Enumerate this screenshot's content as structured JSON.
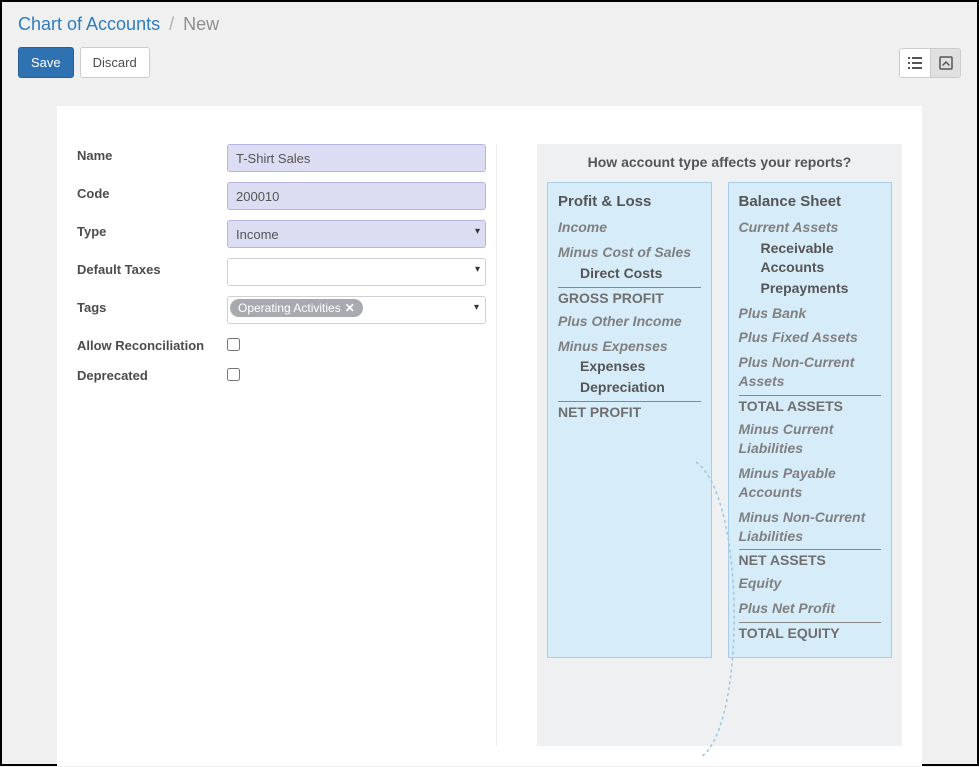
{
  "breadcrumb": {
    "parent": "Chart of Accounts",
    "current": "New"
  },
  "toolbar": {
    "save": "Save",
    "discard": "Discard"
  },
  "form": {
    "labels": {
      "name": "Name",
      "code": "Code",
      "type": "Type",
      "default_taxes": "Default Taxes",
      "tags": "Tags",
      "allow_reconciliation": "Allow Reconciliation",
      "deprecated": "Deprecated"
    },
    "values": {
      "name": "T-Shirt Sales",
      "code": "200010",
      "type": "Income",
      "default_taxes": "",
      "tags": [
        "Operating Activities"
      ],
      "allow_reconciliation": false,
      "deprecated": false
    }
  },
  "info": {
    "title": "How account type affects your reports?",
    "pl": {
      "title": "Profit & Loss",
      "income": "Income",
      "minus_cos": "Minus Cost of Sales",
      "direct_costs": "Direct Costs",
      "gross_profit": "GROSS PROFIT",
      "plus_other_income": "Plus Other Income",
      "minus_expenses": "Minus Expenses",
      "expenses": "Expenses",
      "depreciation": "Depreciation",
      "net_profit": "NET PROFIT"
    },
    "bs": {
      "title": "Balance Sheet",
      "current_assets": "Current Assets",
      "receivable": "Receivable Accounts",
      "prepayments": "Prepayments",
      "plus_bank": "Plus Bank",
      "plus_fixed": "Plus Fixed Assets",
      "plus_noncurrent": "Plus Non-Current Assets",
      "total_assets": "TOTAL ASSETS",
      "minus_current_liab": "Minus Current Liabilities",
      "minus_payable": "Minus Payable Accounts",
      "minus_noncurrent_liab": "Minus Non-Current Liabilities",
      "net_assets": "NET ASSETS",
      "equity": "Equity",
      "plus_net_profit": "Plus Net Profit",
      "total_equity": "TOTAL EQUITY"
    }
  }
}
